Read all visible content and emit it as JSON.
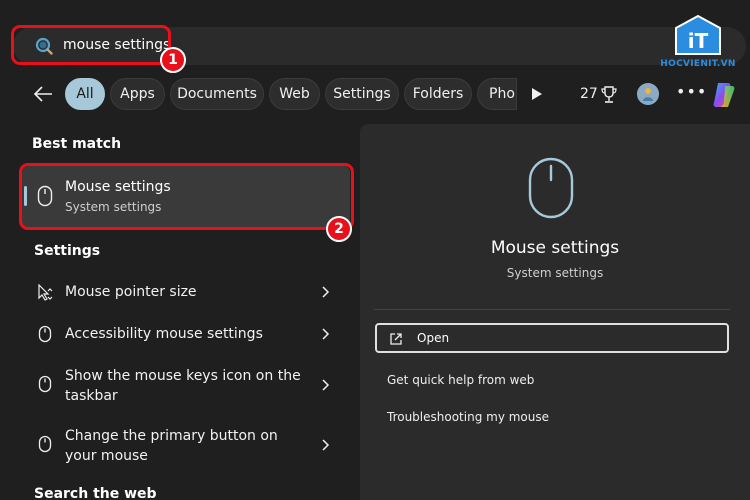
{
  "search": {
    "query": "mouse settings"
  },
  "annotations": {
    "badge1": "1",
    "badge2": "2"
  },
  "logo": {
    "text": "HOCVIENIT.VN",
    "mark": "iT"
  },
  "filters": {
    "tabs": [
      {
        "label": "All",
        "active": true
      },
      {
        "label": "Apps"
      },
      {
        "label": "Documents"
      },
      {
        "label": "Web"
      },
      {
        "label": "Settings"
      },
      {
        "label": "Folders"
      },
      {
        "label": "Pho"
      }
    ],
    "points": "27"
  },
  "results": {
    "best_match_heading": "Best match",
    "best_match": {
      "title": "Mouse settings",
      "subtitle": "System settings"
    },
    "settings_heading": "Settings",
    "settings_items": [
      {
        "line1": "Mouse pointer size",
        "line2": ""
      },
      {
        "line1": "Accessibility mouse settings",
        "line2": ""
      },
      {
        "line1": "Show the mouse keys icon on the",
        "line2": "taskbar"
      },
      {
        "line1": "Change the primary button on",
        "line2": "your mouse"
      }
    ],
    "web_heading": "Search the web"
  },
  "preview": {
    "title": "Mouse settings",
    "subtitle": "System settings",
    "open_label": "Open",
    "actions": [
      "Get quick help from web",
      "Troubleshooting my mouse"
    ]
  },
  "colors": {
    "highlight": "#e8101b",
    "accent": "#a7c8d9",
    "logo": "#2a8de0"
  }
}
